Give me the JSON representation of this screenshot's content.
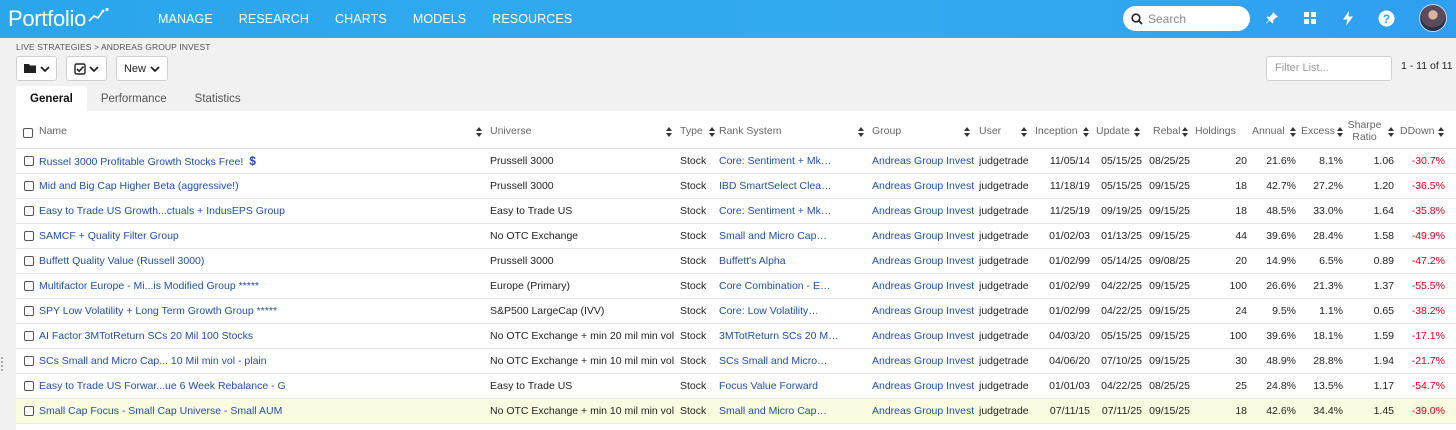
{
  "app": {
    "logo_text": "Portfolio",
    "brand_color": "#2ea6ee"
  },
  "nav": [
    {
      "label": "MANAGE",
      "name": "nav-manage"
    },
    {
      "label": "RESEARCH",
      "name": "nav-research"
    },
    {
      "label": "CHARTS",
      "name": "nav-charts"
    },
    {
      "label": "MODELS",
      "name": "nav-models"
    },
    {
      "label": "RESOURCES",
      "name": "nav-resources"
    }
  ],
  "search": {
    "placeholder": "Search",
    "icon": "search-icon"
  },
  "top_icons": [
    "pin-icon",
    "grid-icon",
    "bolt-icon",
    "help-icon"
  ],
  "breadcrumb": "LIVE STRATEGIES > ANDREAS GROUP INVEST",
  "toolbar": {
    "folder_icon": "folder-icon",
    "check_icon": "check-square-icon",
    "new_label": "New"
  },
  "filter": {
    "placeholder": "Filter List..."
  },
  "pager": "1 - 11 of 11",
  "tabs": [
    {
      "label": "General",
      "active": true
    },
    {
      "label": "Performance",
      "active": false
    },
    {
      "label": "Statistics",
      "active": false
    }
  ],
  "columns": {
    "name": "Name",
    "universe": "Universe",
    "type": "Type",
    "rank": "Rank System",
    "group": "Group",
    "user": "User",
    "inception": "Inception",
    "update": "Update",
    "rebal": "Rebal",
    "holdings": "Holdings",
    "annual": "Annual",
    "excess": "Excess",
    "sharpe_line1": "Sharpe",
    "sharpe_line2": "Ratio",
    "ddown": "DDown"
  },
  "rows": [
    {
      "name": "Russel 3000 Profitable Growth Stocks Free!",
      "badge": "$",
      "universe": "Prussell 3000",
      "type": "Stock",
      "rank": "Core: Sentiment + Mk…",
      "group": "Andreas Group Invest",
      "user": "judgetrade",
      "inception": "11/05/14",
      "update": "05/15/25",
      "rebal": "08/25/25",
      "holdings": "20",
      "annual": "21.6%",
      "excess": "8.1%",
      "sharpe": "1.06",
      "ddown": "-30.7%",
      "highlight": false
    },
    {
      "name": "Mid and Big Cap Higher Beta (aggressive!)",
      "badge": "",
      "universe": "Prussell 3000",
      "type": "Stock",
      "rank": "IBD SmartSelect Clea…",
      "group": "Andreas Group Invest",
      "user": "judgetrade",
      "inception": "11/18/19",
      "update": "05/15/25",
      "rebal": "09/15/25",
      "holdings": "18",
      "annual": "42.7%",
      "excess": "27.2%",
      "sharpe": "1.20",
      "ddown": "-36.5%",
      "highlight": false
    },
    {
      "name": "Easy to Trade US Growth...ctuals + IndusEPS Group",
      "badge": "",
      "universe": "Easy to Trade US",
      "type": "Stock",
      "rank": "Core: Sentiment + Mk…",
      "group": "Andreas Group Invest",
      "user": "judgetrade",
      "inception": "11/25/19",
      "update": "09/19/25",
      "rebal": "09/15/25",
      "holdings": "18",
      "annual": "48.5%",
      "excess": "33.0%",
      "sharpe": "1.64",
      "ddown": "-35.8%",
      "highlight": false
    },
    {
      "name": "SAMCF + Quality Filter Group",
      "badge": "",
      "universe": "No OTC Exchange",
      "type": "Stock",
      "rank": "Small and Micro Cap…",
      "group": "Andreas Group Invest",
      "user": "judgetrade",
      "inception": "01/02/03",
      "update": "01/13/25",
      "rebal": "09/15/25",
      "holdings": "44",
      "annual": "39.6%",
      "excess": "28.4%",
      "sharpe": "1.58",
      "ddown": "-49.9%",
      "highlight": false
    },
    {
      "name": "Buffett Quality Value (Russell 3000)",
      "badge": "",
      "universe": "Prussell 3000",
      "type": "Stock",
      "rank": "Buffett's Alpha",
      "group": "Andreas Group Invest",
      "user": "judgetrade",
      "inception": "01/02/99",
      "update": "05/14/25",
      "rebal": "09/08/25",
      "holdings": "20",
      "annual": "14.9%",
      "excess": "6.5%",
      "sharpe": "0.89",
      "ddown": "-47.2%",
      "highlight": false
    },
    {
      "name": "Multifactor Europe - Mi...is Modified Group *****",
      "badge": "",
      "universe": "Europe (Primary)",
      "type": "Stock",
      "rank": "Core Combination - E…",
      "group": "Andreas Group Invest",
      "user": "judgetrade",
      "inception": "01/02/99",
      "update": "04/22/25",
      "rebal": "09/15/25",
      "holdings": "100",
      "annual": "26.6%",
      "excess": "21.3%",
      "sharpe": "1.37",
      "ddown": "-55.5%",
      "highlight": false
    },
    {
      "name": "SPY Low Volatility + Long Term Growth Group *****",
      "badge": "",
      "universe": "S&P500 LargeCap (IVV)",
      "type": "Stock",
      "rank": "Core: Low Volatility…",
      "group": "Andreas Group Invest",
      "user": "judgetrade",
      "inception": "01/02/99",
      "update": "04/22/25",
      "rebal": "09/15/25",
      "holdings": "24",
      "annual": "9.5%",
      "excess": "1.1%",
      "sharpe": "0.65",
      "ddown": "-38.2%",
      "highlight": false
    },
    {
      "name": "AI Factor 3MTotReturn SCs 20 Mil 100 Stocks",
      "badge": "",
      "universe": "No OTC Exchange + min 20 mil min vol",
      "type": "Stock",
      "rank": "3MTotReturn SCs 20 M…",
      "group": "Andreas Group Invest",
      "user": "judgetrade",
      "inception": "04/03/20",
      "update": "05/15/25",
      "rebal": "09/15/25",
      "holdings": "100",
      "annual": "39.6%",
      "excess": "18.1%",
      "sharpe": "1.59",
      "ddown": "-17.1%",
      "highlight": false
    },
    {
      "name": "SCs Small and Micro Cap... 10 Mil min vol - plain",
      "badge": "",
      "universe": "No OTC Exchange + min 10 mil min vol",
      "type": "Stock",
      "rank": "SCs Small and Micro…",
      "group": "Andreas Group Invest",
      "user": "judgetrade",
      "inception": "04/06/20",
      "update": "07/10/25",
      "rebal": "09/15/25",
      "holdings": "30",
      "annual": "48.9%",
      "excess": "28.8%",
      "sharpe": "1.94",
      "ddown": "-21.7%",
      "highlight": false
    },
    {
      "name": "Easy to Trade US Forwar...ue 6 Week Rebalance - G",
      "badge": "",
      "universe": "Easy to Trade US",
      "type": "Stock",
      "rank": "Focus Value Forward",
      "group": "Andreas Group Invest",
      "user": "judgetrade",
      "inception": "01/01/03",
      "update": "04/22/25",
      "rebal": "08/25/25",
      "holdings": "25",
      "annual": "24.8%",
      "excess": "13.5%",
      "sharpe": "1.17",
      "ddown": "-54.7%",
      "highlight": false
    },
    {
      "name": "Small Cap Focus - Small Cap Universe - Small AUM",
      "badge": "",
      "universe": "No OTC Exchange + min 10 mil min vol",
      "type": "Stock",
      "rank": "Small and Micro Cap…",
      "group": "Andreas Group Invest",
      "user": "judgetrade",
      "inception": "07/11/15",
      "update": "07/11/25",
      "rebal": "09/15/25",
      "holdings": "18",
      "annual": "42.6%",
      "excess": "34.4%",
      "sharpe": "1.45",
      "ddown": "-39.0%",
      "highlight": true
    }
  ]
}
